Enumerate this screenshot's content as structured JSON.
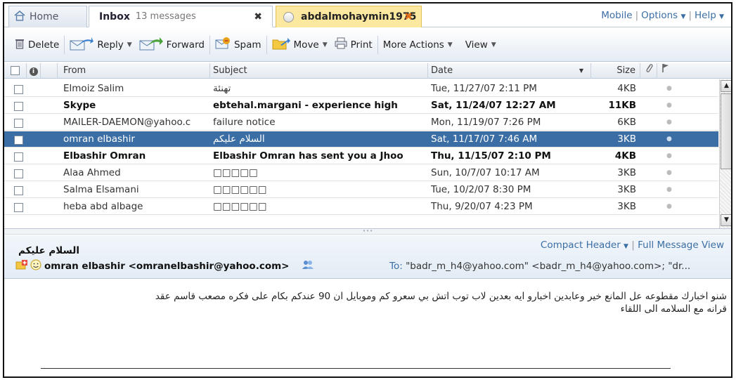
{
  "tabs": {
    "home_label": "Home",
    "inbox_label": "Inbox",
    "inbox_count": "13 messages",
    "close_glyph": "✖",
    "chat_label": "abdalmohaymin1975",
    "chat_close_glyph": "✖"
  },
  "top_links": {
    "mobile": "Mobile",
    "options": "Options",
    "help": "Help",
    "sep": "|"
  },
  "toolbar": {
    "delete": "Delete",
    "reply": "Reply",
    "forward": "Forward",
    "spam": "Spam",
    "move": "Move",
    "print": "Print",
    "more_actions": "More Actions",
    "view": "View"
  },
  "columns": {
    "from": "From",
    "subject": "Subject",
    "date": "Date",
    "size": "Size"
  },
  "messages": [
    {
      "from": "Elmoiz Salim",
      "subject": "تهنئة",
      "date": "Tue, 11/27/07 2:11 PM",
      "size": "4KB",
      "unread": false,
      "selected": false
    },
    {
      "from": "Skype",
      "subject": "ebtehal.margani - experience high",
      "date": "Sat, 11/24/07 12:27 AM",
      "size": "11KB",
      "unread": true,
      "selected": false
    },
    {
      "from": "MAILER-DAEMON@yahoo.c",
      "subject": "failure notice",
      "date": "Mon, 11/19/07 7:26 PM",
      "size": "6KB",
      "unread": false,
      "selected": false
    },
    {
      "from": "omran elbashir",
      "subject": "السلام عليكم",
      "date": "Sat, 11/17/07 7:46 AM",
      "size": "3KB",
      "unread": false,
      "selected": true
    },
    {
      "from": "Elbashir Omran",
      "subject": "Elbashir Omran has sent you a Jhoo",
      "date": "Thu, 11/15/07 2:10 PM",
      "size": "4KB",
      "unread": true,
      "selected": false
    },
    {
      "from": "Alaa Ahmed",
      "subject": "□□□□□",
      "date": "Sun, 10/7/07 10:17 AM",
      "size": "3KB",
      "unread": false,
      "selected": false
    },
    {
      "from": "Salma Elsamani",
      "subject": "□□□□□□",
      "date": "Tue, 10/2/07 8:30 PM",
      "size": "3KB",
      "unread": false,
      "selected": false
    },
    {
      "from": "heba abd albage",
      "subject": "□□□□□□",
      "date": "Thu, 9/20/07 4:23 PM",
      "size": "3KB",
      "unread": false,
      "selected": false
    }
  ],
  "preview": {
    "subject": "السلام عليكم",
    "compact_header": "Compact Header",
    "full_view": "Full Message View",
    "from": "omran elbashir <omranelbashir@yahoo.com>",
    "to_label": "To:",
    "to_value": "\"badr_m_h4@yahoo.com\" <badr_m_h4@yahoo.com>; \"dr...",
    "body_line1": "شنو اخبارك مقطوعه عل المانع خير وعابدين اخبارو ايه بعدين لاب توب اتش بي سعرو كم وموبايل ان 90 عندكم بكام على فكره مصعب قاسم عقد",
    "body_line2": "قرانه مع السلامه الى اللقاء"
  },
  "colors": {
    "selection": "#3b6ea5",
    "link": "#3b6ea5",
    "chat_tab": "#fde8a0"
  }
}
